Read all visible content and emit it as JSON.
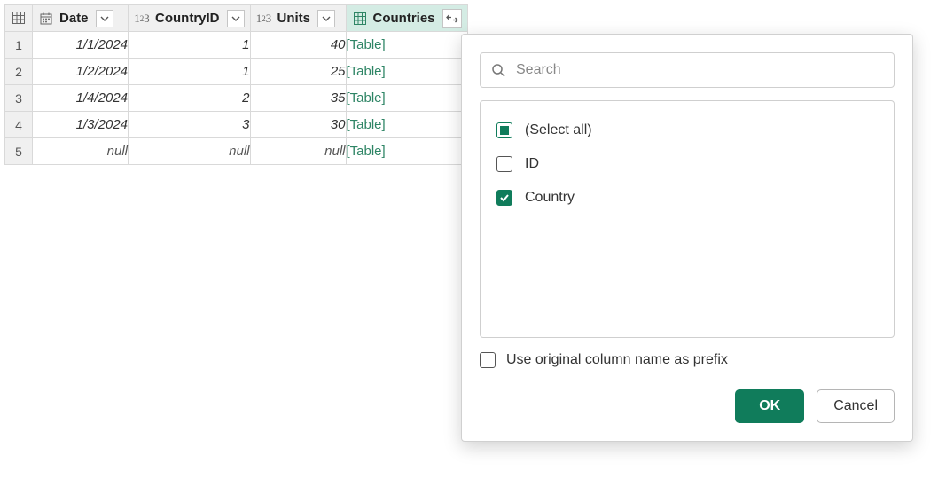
{
  "columns": {
    "date": "Date",
    "countryId": "CountryID",
    "units": "Units",
    "countries": "Countries"
  },
  "rows": [
    {
      "n": "1",
      "date": "1/1/2024",
      "countryId": "1",
      "units": "40",
      "countries": "[Table]"
    },
    {
      "n": "2",
      "date": "1/2/2024",
      "countryId": "1",
      "units": "25",
      "countries": "[Table]"
    },
    {
      "n": "3",
      "date": "1/4/2024",
      "countryId": "2",
      "units": "35",
      "countries": "[Table]"
    },
    {
      "n": "4",
      "date": "1/3/2024",
      "countryId": "3",
      "units": "30",
      "countries": "[Table]"
    },
    {
      "n": "5",
      "date": "null",
      "countryId": "null",
      "units": "null",
      "countries": "[Table]"
    }
  ],
  "popup": {
    "searchPlaceholder": "Search",
    "options": {
      "selectAll": "(Select all)",
      "id": "ID",
      "country": "Country"
    },
    "prefixLabel": "Use original column name as prefix",
    "ok": "OK",
    "cancel": "Cancel"
  }
}
